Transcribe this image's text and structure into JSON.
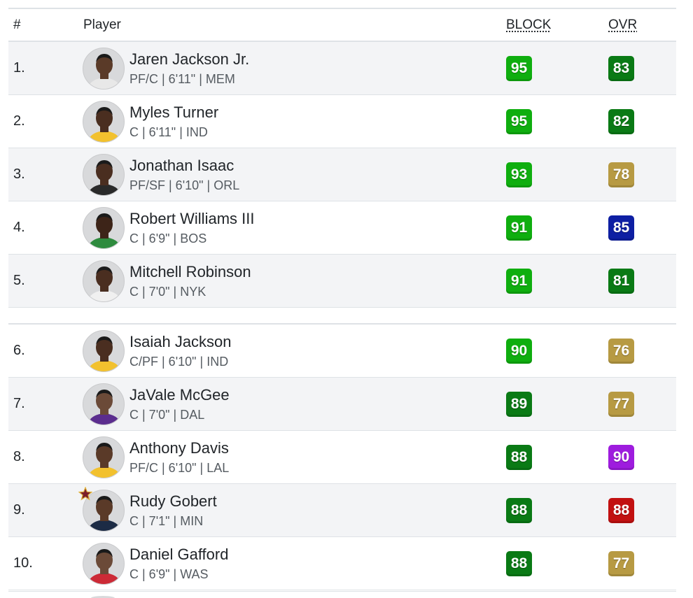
{
  "header": {
    "rank": "#",
    "player": "Player",
    "block": "BLOCK",
    "ovr": "OVR"
  },
  "colors": {
    "bright_green": "#0fae0f",
    "dark_green": "#0a7a15",
    "gold": "#b79a43",
    "blue": "#0e1fa3",
    "purple": "#9e1cde",
    "red": "#c21111"
  },
  "players": [
    {
      "rank": "1.",
      "name": "Jaren Jackson Jr.",
      "info": "PF/C | 6'11\" | MEM",
      "block": "95",
      "ovr": "83",
      "block_tier": "bright_green",
      "ovr_tier": "dark_green",
      "jersey_color": "#e8e8e8",
      "skin": "#5a3a28",
      "allstar": false
    },
    {
      "rank": "2.",
      "name": "Myles Turner",
      "info": "C | 6'11\" | IND",
      "block": "95",
      "ovr": "82",
      "block_tier": "bright_green",
      "ovr_tier": "dark_green",
      "jersey_color": "#f2c12e",
      "skin": "#4a2e20",
      "allstar": false
    },
    {
      "rank": "3.",
      "name": "Jonathan Isaac",
      "info": "PF/SF | 6'10\" | ORL",
      "block": "93",
      "ovr": "78",
      "block_tier": "bright_green",
      "ovr_tier": "gold",
      "jersey_color": "#2a2a2a",
      "skin": "#4a2e20",
      "allstar": false
    },
    {
      "rank": "4.",
      "name": "Robert Williams III",
      "info": "C | 6'9\" | BOS",
      "block": "91",
      "ovr": "85",
      "block_tier": "bright_green",
      "ovr_tier": "blue",
      "jersey_color": "#2e8b3e",
      "skin": "#3d2418",
      "allstar": false
    },
    {
      "rank": "5.",
      "name": "Mitchell Robinson",
      "info": "C | 7'0\" | NYK",
      "block": "91",
      "ovr": "81",
      "block_tier": "bright_green",
      "ovr_tier": "dark_green",
      "jersey_color": "#f0f0f0",
      "skin": "#4a2e20",
      "allstar": false
    },
    {
      "rank": "6.",
      "name": "Isaiah Jackson",
      "info": "C/PF | 6'10\" | IND",
      "block": "90",
      "ovr": "76",
      "block_tier": "bright_green",
      "ovr_tier": "gold",
      "jersey_color": "#f2c12e",
      "skin": "#4a2e20",
      "allstar": false
    },
    {
      "rank": "7.",
      "name": "JaVale McGee",
      "info": "C | 7'0\" | DAL",
      "block": "89",
      "ovr": "77",
      "block_tier": "dark_green",
      "ovr_tier": "gold",
      "jersey_color": "#5b2d8e",
      "skin": "#6b4a38",
      "allstar": false
    },
    {
      "rank": "8.",
      "name": "Anthony Davis",
      "info": "PF/C | 6'10\" | LAL",
      "block": "88",
      "ovr": "90",
      "block_tier": "dark_green",
      "ovr_tier": "purple",
      "jersey_color": "#f2c12e",
      "skin": "#5a3a28",
      "allstar": false
    },
    {
      "rank": "9.",
      "name": "Rudy Gobert",
      "info": "C | 7'1\" | MIN",
      "block": "88",
      "ovr": "88",
      "block_tier": "dark_green",
      "ovr_tier": "red",
      "jersey_color": "#1c2b45",
      "skin": "#5a3a28",
      "allstar": true
    },
    {
      "rank": "10.",
      "name": "Daniel Gafford",
      "info": "C | 6'9\" | WAS",
      "block": "88",
      "ovr": "77",
      "block_tier": "dark_green",
      "ovr_tier": "gold",
      "jersey_color": "#cc2a36",
      "skin": "#6b4a38",
      "allstar": false
    }
  ]
}
